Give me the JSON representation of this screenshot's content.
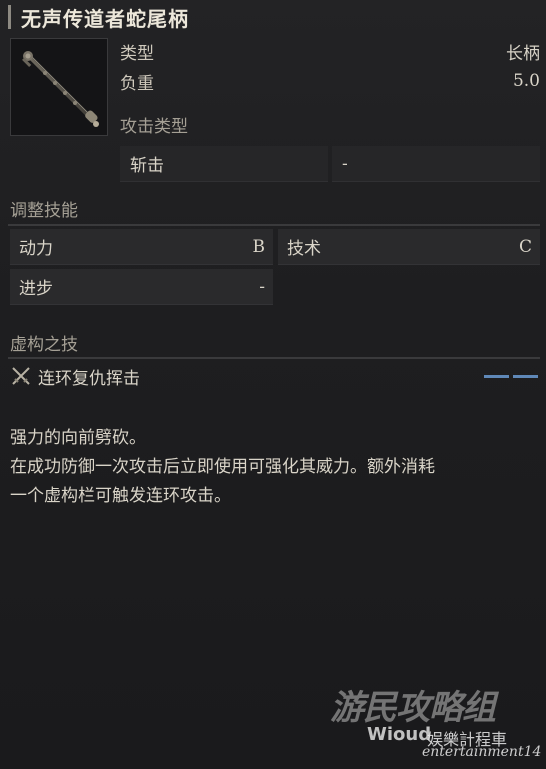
{
  "item": {
    "name": "无声传道者蛇尾柄",
    "stats": [
      {
        "label": "类型",
        "value": "长柄"
      },
      {
        "label": "负重",
        "value": "5.0"
      }
    ]
  },
  "attack_type": {
    "section_label": "攻击类型",
    "primary": "斩击",
    "secondary": "-"
  },
  "scaling": {
    "section_label": "调整技能",
    "power": {
      "label": "动力",
      "grade": "B"
    },
    "technique": {
      "label": "技术",
      "grade": "C"
    },
    "progress": {
      "label": "进步",
      "grade": "-"
    }
  },
  "skill": {
    "section_label": "虚构之技",
    "name": "连环复仇挥击",
    "icon": "crossed-swords-icon",
    "fp_cost_bars": 2
  },
  "description": {
    "line1": "强力的向前劈砍。",
    "line2": "在成功防御一次攻击后立即使用可强化其威力。额外消耗",
    "line3": "一个虚构栏可触发连环攻击。"
  },
  "watermark": {
    "main": "游民攻略组",
    "sub_left": "Wioud",
    "sub_right": "娱樂計程車",
    "sub_bottom": "entertainment14"
  },
  "colors": {
    "background": "#1d1d1f",
    "cell": "#2a2a2c",
    "text": "#d9d4c8",
    "muted": "#a5a095",
    "fp_bar": "#5f88b8"
  }
}
